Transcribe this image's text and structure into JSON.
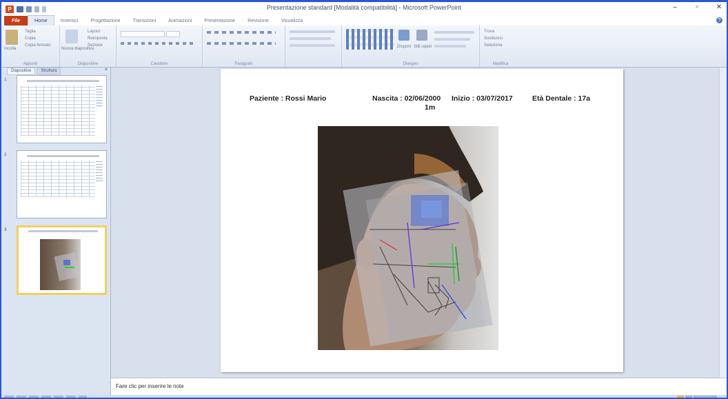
{
  "window": {
    "title": "Presentazione standard [Modalità compatibilità] - Microsoft PowerPoint",
    "min_label": "–",
    "max_label": "▫",
    "close_label": "✕"
  },
  "ribbon_tabs": {
    "file": "File",
    "items": [
      "Home",
      "Inserisci",
      "Progettazione",
      "Transizioni",
      "Animazioni",
      "Presentazione",
      "Revisione",
      "Visualizza"
    ]
  },
  "ribbon": {
    "groups": {
      "appunti": "Appunti",
      "diapositive": "Diapositive",
      "carattere": "Carattere",
      "paragrafo": "Paragrafo",
      "disegno": "Disegno",
      "modifica": "Modifica"
    },
    "incolla": "Incolla",
    "taglia": "Taglia",
    "copia": "Copia",
    "copia_formato": "Copia formato",
    "nuova_diapositiva": "Nuova diapositiva",
    "layout": "Layout",
    "reimposta": "Reimposta",
    "sezione": "Sezione",
    "trova": "Trova",
    "sostituisci": "Sostituisci",
    "seleziona": "Seleziona",
    "disponi": "Disponi",
    "stili_rapidi": "Stili rapidi"
  },
  "side_panel": {
    "tab_slides": "Diapositive",
    "tab_outline": "Struttura",
    "close": "×",
    "slide_numbers": [
      "1",
      "2",
      "3"
    ]
  },
  "slide": {
    "patient": "Paziente : Rossi Mario",
    "birth": "Nascita : 02/06/2000",
    "start": "Inizio : 03/07/2017",
    "dental_age": "Età Dentale : 17a",
    "dental_age_cont": "1m"
  },
  "notes": {
    "placeholder": "Fare clic per inserire le note"
  },
  "colors": {
    "file_tab": "#c53d17",
    "selected_thumb": "#f3cf5b",
    "window_border": "#2b56d6"
  }
}
